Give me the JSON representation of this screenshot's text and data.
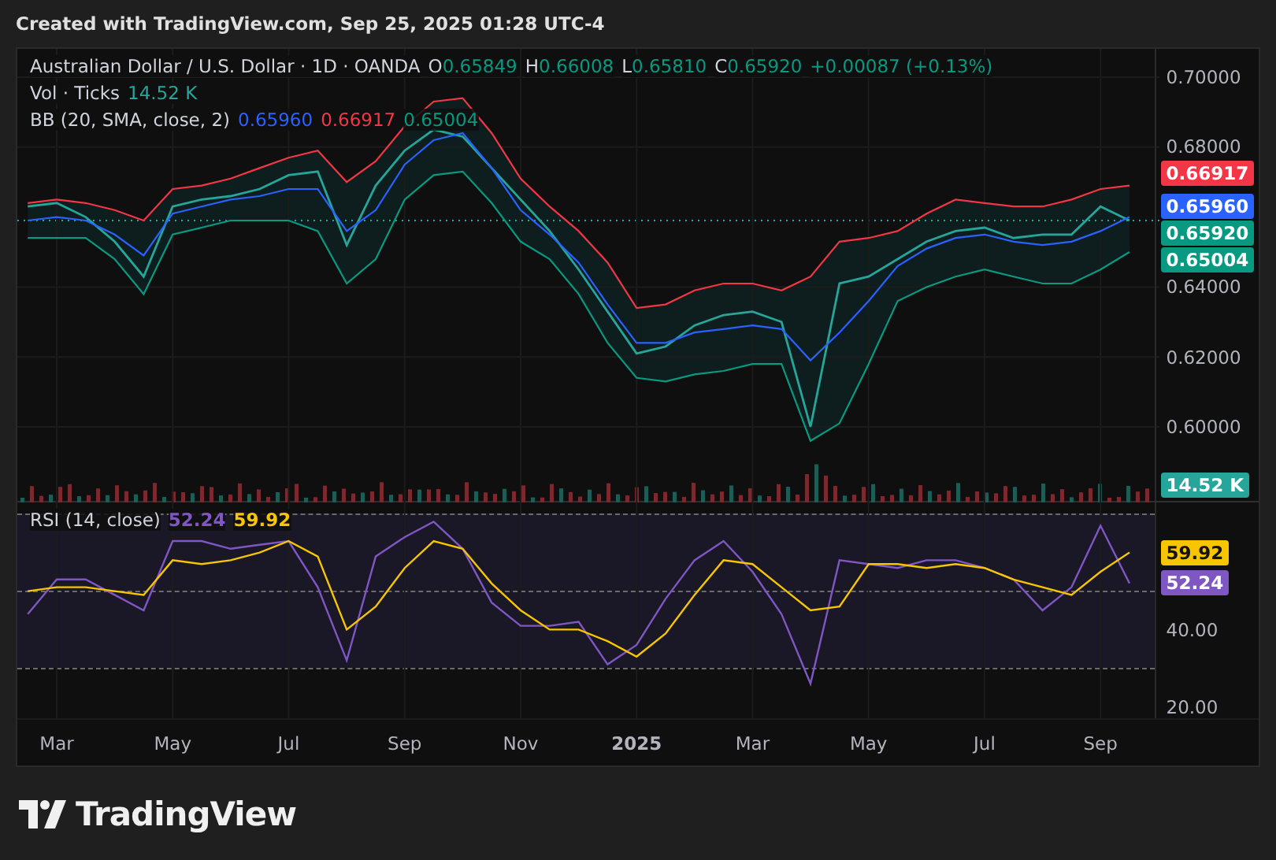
{
  "header": {
    "text": "Created with TradingView.com, Sep 25, 2025 01:28 UTC-4"
  },
  "legend": {
    "symbol": "Australian Dollar / U.S. Dollar · 1D · OANDA",
    "ohlc": [
      {
        "key": "O",
        "value": "0.65849"
      },
      {
        "key": "H",
        "value": "0.66008"
      },
      {
        "key": "L",
        "value": "0.65810"
      },
      {
        "key": "C",
        "value": "0.65920"
      }
    ],
    "change": "+0.00087 (+0.13%)"
  },
  "volume_legend": {
    "label": "Vol · Ticks",
    "value": "14.52 K"
  },
  "bb_legend": {
    "label": "BB (20, SMA, close, 2)",
    "values": [
      {
        "text": "0.65960",
        "color": "#2962ff"
      },
      {
        "text": "0.66917",
        "color": "#f23645"
      },
      {
        "text": "0.65004",
        "color": "#089981"
      }
    ]
  },
  "price_pane": {
    "chart_data": {
      "type": "line",
      "grid": true,
      "series": [
        {
          "color": "#26a69a",
          "values": [
            0.663,
            0.664,
            0.66,
            0.653,
            0.643,
            0.663,
            0.665,
            0.666,
            0.668,
            0.672,
            0.673,
            0.652,
            0.669,
            0.679,
            0.685,
            0.683,
            0.674,
            0.665,
            0.656,
            0.645,
            0.633,
            0.621,
            0.623,
            0.629,
            0.632,
            0.633,
            0.63,
            0.6,
            0.641,
            0.643,
            0.648,
            0.653,
            0.656,
            0.657,
            0.654,
            0.655,
            0.655,
            0.663,
            0.659
          ]
        },
        {
          "color": "#f23645",
          "values": [
            0.664,
            0.665,
            0.664,
            0.662,
            0.659,
            0.668,
            0.669,
            0.671,
            0.674,
            0.677,
            0.679,
            0.67,
            0.676,
            0.686,
            0.693,
            0.694,
            0.684,
            0.671,
            0.663,
            0.656,
            0.647,
            0.634,
            0.635,
            0.639,
            0.641,
            0.641,
            0.639,
            0.643,
            0.653,
            0.654,
            0.656,
            0.661,
            0.665,
            0.664,
            0.663,
            0.663,
            0.665,
            0.668,
            0.669
          ]
        },
        {
          "color": "#2962ff",
          "values": [
            0.659,
            0.66,
            0.659,
            0.655,
            0.649,
            0.661,
            0.663,
            0.665,
            0.666,
            0.668,
            0.668,
            0.656,
            0.662,
            0.675,
            0.682,
            0.684,
            0.674,
            0.662,
            0.655,
            0.647,
            0.635,
            0.624,
            0.624,
            0.627,
            0.628,
            0.629,
            0.628,
            0.619,
            0.627,
            0.636,
            0.646,
            0.651,
            0.654,
            0.655,
            0.653,
            0.652,
            0.653,
            0.656,
            0.66
          ]
        },
        {
          "color": "#089981",
          "values": [
            0.654,
            0.654,
            0.654,
            0.648,
            0.638,
            0.655,
            0.657,
            0.659,
            0.659,
            0.659,
            0.656,
            0.641,
            0.648,
            0.665,
            0.672,
            0.673,
            0.664,
            0.653,
            0.648,
            0.638,
            0.624,
            0.614,
            0.613,
            0.615,
            0.616,
            0.618,
            0.618,
            0.596,
            0.601,
            0.618,
            0.636,
            0.64,
            0.643,
            0.645,
            0.643,
            0.641,
            0.641,
            0.645,
            0.65
          ]
        }
      ],
      "ylim": [
        0.5784,
        0.7081
      ],
      "yticks": [
        {
          "value": 0.7,
          "label": "0.70000"
        },
        {
          "value": 0.68,
          "label": "0.68000"
        },
        {
          "value": 0.64,
          "label": "0.64000"
        },
        {
          "value": 0.62,
          "label": "0.62000"
        },
        {
          "value": 0.6,
          "label": "0.60000"
        }
      ]
    },
    "price_labels": [
      {
        "text": "0.66917",
        "color": "#f23645"
      },
      {
        "text": "0.65960",
        "color": "#2962ff"
      },
      {
        "text": "0.65920",
        "color": "#089981"
      },
      {
        "text": "0.65004",
        "color": "#089981"
      }
    ],
    "volume_label": "14.52 K"
  },
  "rsi_legend": {
    "label": "RSI (14, close)",
    "values": [
      {
        "text": "52.24",
        "color": "#7e57c2"
      },
      {
        "text": "59.92",
        "color": "#f7c600"
      }
    ]
  },
  "rsi_pane": {
    "chart_data": {
      "type": "line",
      "grid": true,
      "categories": [
        null,
        "Mar",
        null,
        null,
        null,
        "May",
        null,
        null,
        null,
        "Jul",
        null,
        null,
        null,
        "Sep",
        null,
        null,
        null,
        "Nov",
        null,
        null,
        null,
        "2025",
        null,
        null,
        null,
        "Mar",
        null,
        null,
        null,
        "May",
        null,
        null,
        null,
        "Jul",
        null,
        null,
        null,
        "Sep",
        null
      ],
      "series": [
        {
          "color": "#7e57c2",
          "values": [
            44,
            53,
            53,
            49,
            45,
            63,
            63,
            61,
            62,
            63,
            51,
            32,
            59,
            64,
            68,
            61,
            47,
            41,
            41,
            42,
            31,
            36,
            48,
            58,
            63,
            55,
            44,
            26,
            58,
            57,
            56,
            58,
            58,
            56,
            53,
            45,
            51,
            67,
            52
          ]
        },
        {
          "color": "#f7c600",
          "values": [
            50,
            51,
            51,
            50,
            49,
            58,
            57,
            58,
            60,
            63,
            59,
            40,
            46,
            56,
            63,
            61,
            52,
            45,
            40,
            40,
            37,
            33,
            39,
            49,
            58,
            57,
            51,
            45,
            46,
            57,
            57,
            56,
            57,
            56,
            53,
            51,
            49,
            55,
            60
          ]
        }
      ],
      "ylim": [
        17,
        73
      ],
      "yticks": [
        {
          "value": 40,
          "label": "40.00"
        },
        {
          "value": 20,
          "label": "20.00"
        }
      ]
    },
    "rsi_labels": [
      {
        "text": "59.92",
        "color": "#f7c600"
      },
      {
        "text": "52.24",
        "color": "#7e57c2"
      }
    ]
  },
  "brand": "TradingView"
}
